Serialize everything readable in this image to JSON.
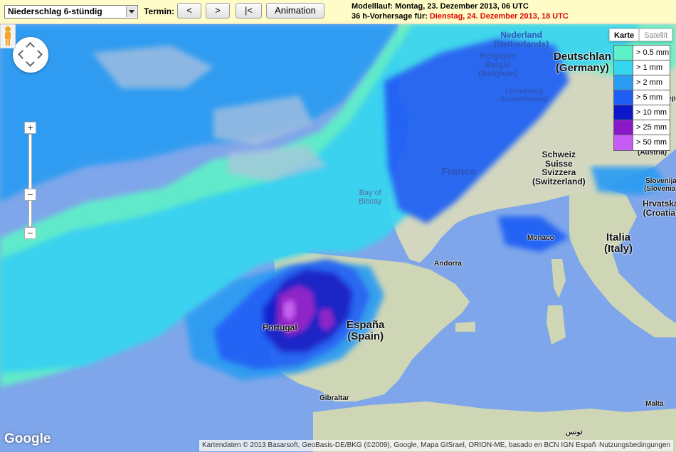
{
  "toolbar": {
    "product_select": "Niederschlag 6-stündig",
    "termin_label": "Termin:",
    "prev_button": "<",
    "next_button": ">",
    "first_button": "|<",
    "animation_button": "Animation"
  },
  "run_info": {
    "model_run": "Modelllauf: Montag, 23. Dezember 2013, 06 UTC",
    "forecast_prefix": "36 h-Vorhersage für:",
    "forecast_time": "Dienstag, 24. Dezember 2013, 18 UTC",
    "forecast_color": "#e00000"
  },
  "map_type": {
    "map": "Karte",
    "satellite": "Satellit",
    "active": "Karte"
  },
  "legend": [
    {
      "label": "> 0.5 mm",
      "color": "#5ef0c8"
    },
    {
      "label": "> 1 mm",
      "color": "#34d6f0"
    },
    {
      "label": "> 2 mm",
      "color": "#2a9cf2"
    },
    {
      "label": "> 5 mm",
      "color": "#1f5ef5"
    },
    {
      "label": "> 10 mm",
      "color": "#0b17c8"
    },
    {
      "label": "> 25 mm",
      "color": "#8a18c8"
    },
    {
      "label": "> 50 mm",
      "color": "#c65cf5"
    }
  ],
  "places": {
    "nederland": "Nederland",
    "nederland_sub": "(Netherlands)",
    "belgique": "Belgique",
    "belgie": "België",
    "belgium": "(Belgium)",
    "letzebuerg": "Lëtzebuerg",
    "luxembourg": "(Luxembourg)",
    "deutschland": "Deutschlan",
    "germany": "(Germany)",
    "france": "France",
    "schweiz": "Schweiz",
    "suisse": "Suisse",
    "svizzera": "Svizzera",
    "switzerland": "(Switzerland)",
    "austria": "(Austria)",
    "slovenija": "Slovenija",
    "slovenia": "(Slovenia)",
    "hrvatska": "Hrvatska",
    "croatia": "(Croatia)",
    "bay": "Bay of",
    "biscay": "Biscay",
    "monaco": "Monaco",
    "andorra": "Andorra",
    "italia": "Italia",
    "italy": "(Italy)",
    "portugal": "Portugal",
    "espana": "España",
    "spain": "(Spain)",
    "gibraltar": "Gibraltar",
    "malta": "Malta",
    "tunis": "تونس",
    "rep": "ep"
  },
  "attribution": {
    "google": "Google",
    "map_data": "Kartendaten © 2013 Basarsoft, GeoBasis-DE/BKG (©2009), Google, Mapa GISrael, ORION-ME, basado en BCN IGN España",
    "terms": "Nutzungsbedingungen"
  }
}
